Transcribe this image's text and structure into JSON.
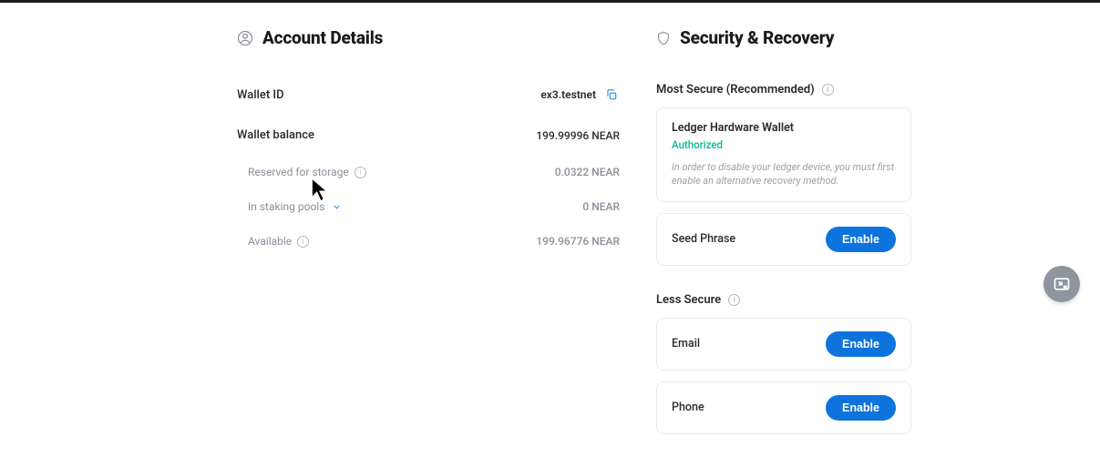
{
  "account": {
    "title": "Account Details",
    "wallet_id_label": "Wallet ID",
    "wallet_id_value": "ex3.testnet",
    "balance_label": "Wallet balance",
    "balance_value": "199.99996 NEAR",
    "reserved_label": "Reserved for storage",
    "reserved_value": "0.0322 NEAR",
    "staking_label": "In staking pools",
    "staking_value": "0 NEAR",
    "available_label": "Available",
    "available_value": "199.96776 NEAR"
  },
  "security": {
    "title": "Security & Recovery",
    "most_secure_label": "Most Secure (Recommended)",
    "ledger": {
      "title": "Ledger Hardware Wallet",
      "status": "Authorized",
      "status_color": "#00b894",
      "note": "In order to disable your ledger device, you must first enable an alternative recovery method."
    },
    "seed_phrase": {
      "label": "Seed Phrase",
      "button": "Enable"
    },
    "less_secure_label": "Less Secure",
    "email": {
      "label": "Email",
      "button": "Enable"
    },
    "phone": {
      "label": "Phone",
      "button": "Enable"
    }
  }
}
